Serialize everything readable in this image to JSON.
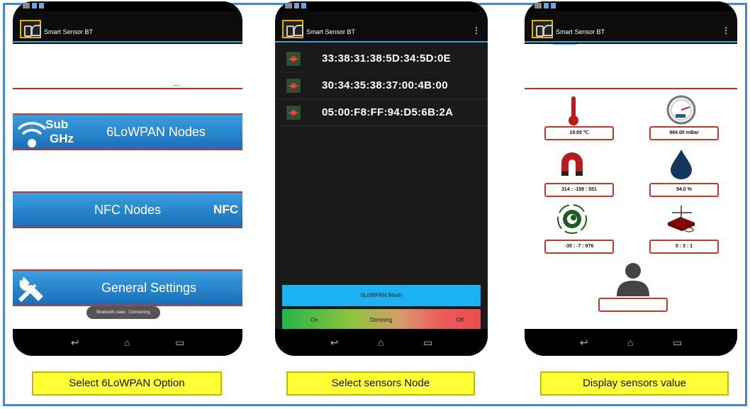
{
  "app_title": "Smart Sensor BT",
  "overflow_icon": "⋮",
  "nav_icons": [
    "back-icon",
    "home-icon",
    "recents-icon"
  ],
  "screen1": {
    "buttons": [
      {
        "label": "6LoWPAN Nodes",
        "icon": "subghz-wifi-icon",
        "icon_text_1": "Sub",
        "icon_text_2": "GHz"
      },
      {
        "label": "NFC Nodes",
        "icon": "nfc-logo-icon",
        "icon_text": "NFC"
      },
      {
        "label": "General Settings",
        "icon": "tools-icon"
      }
    ],
    "toast": "Bluetooth state : Connecting"
  },
  "screen2": {
    "nodes": [
      {
        "address": "33:38:31:38:5D:34:5D:0E",
        "icon": "sensor-node-icon"
      },
      {
        "address": "30:34:35:38:37:00:4B:00",
        "icon": "sensor-node-icon"
      },
      {
        "address": "05:00:F8:FF:94:D5:6B:2A",
        "icon": "sensor-node-icon"
      }
    ],
    "mesh_button": "6LoWPAN Mesh",
    "dimming": {
      "on": "On",
      "dimming": "Dimming",
      "off": "Off"
    }
  },
  "screen3": {
    "sensors": [
      {
        "icon": "thermometer-icon",
        "value": "19.00 ℃"
      },
      {
        "icon": "pressure-gauge-icon",
        "value": "984.00 mBar"
      },
      {
        "icon": "magnet-icon",
        "value": "314 : -159 : 551"
      },
      {
        "icon": "humidity-drop-icon",
        "value": "94.0 %"
      },
      {
        "icon": "gyroscope-icon",
        "value": "-35 : -7 : 976"
      },
      {
        "icon": "accelerometer-icon",
        "value": "0 : 3 : 1"
      },
      {
        "icon": "user-presence-icon",
        "value": ""
      }
    ]
  },
  "captions": [
    "Select 6LoWPAN Option",
    "Select sensors Node",
    "Display sensors value"
  ],
  "colors": {
    "frame_border": "#4f83c9",
    "button_blue": "#1a6fb8",
    "accent_red": "#c62828",
    "mesh_blue": "#1ab2f0",
    "caption_yellow": "#ffff33"
  }
}
